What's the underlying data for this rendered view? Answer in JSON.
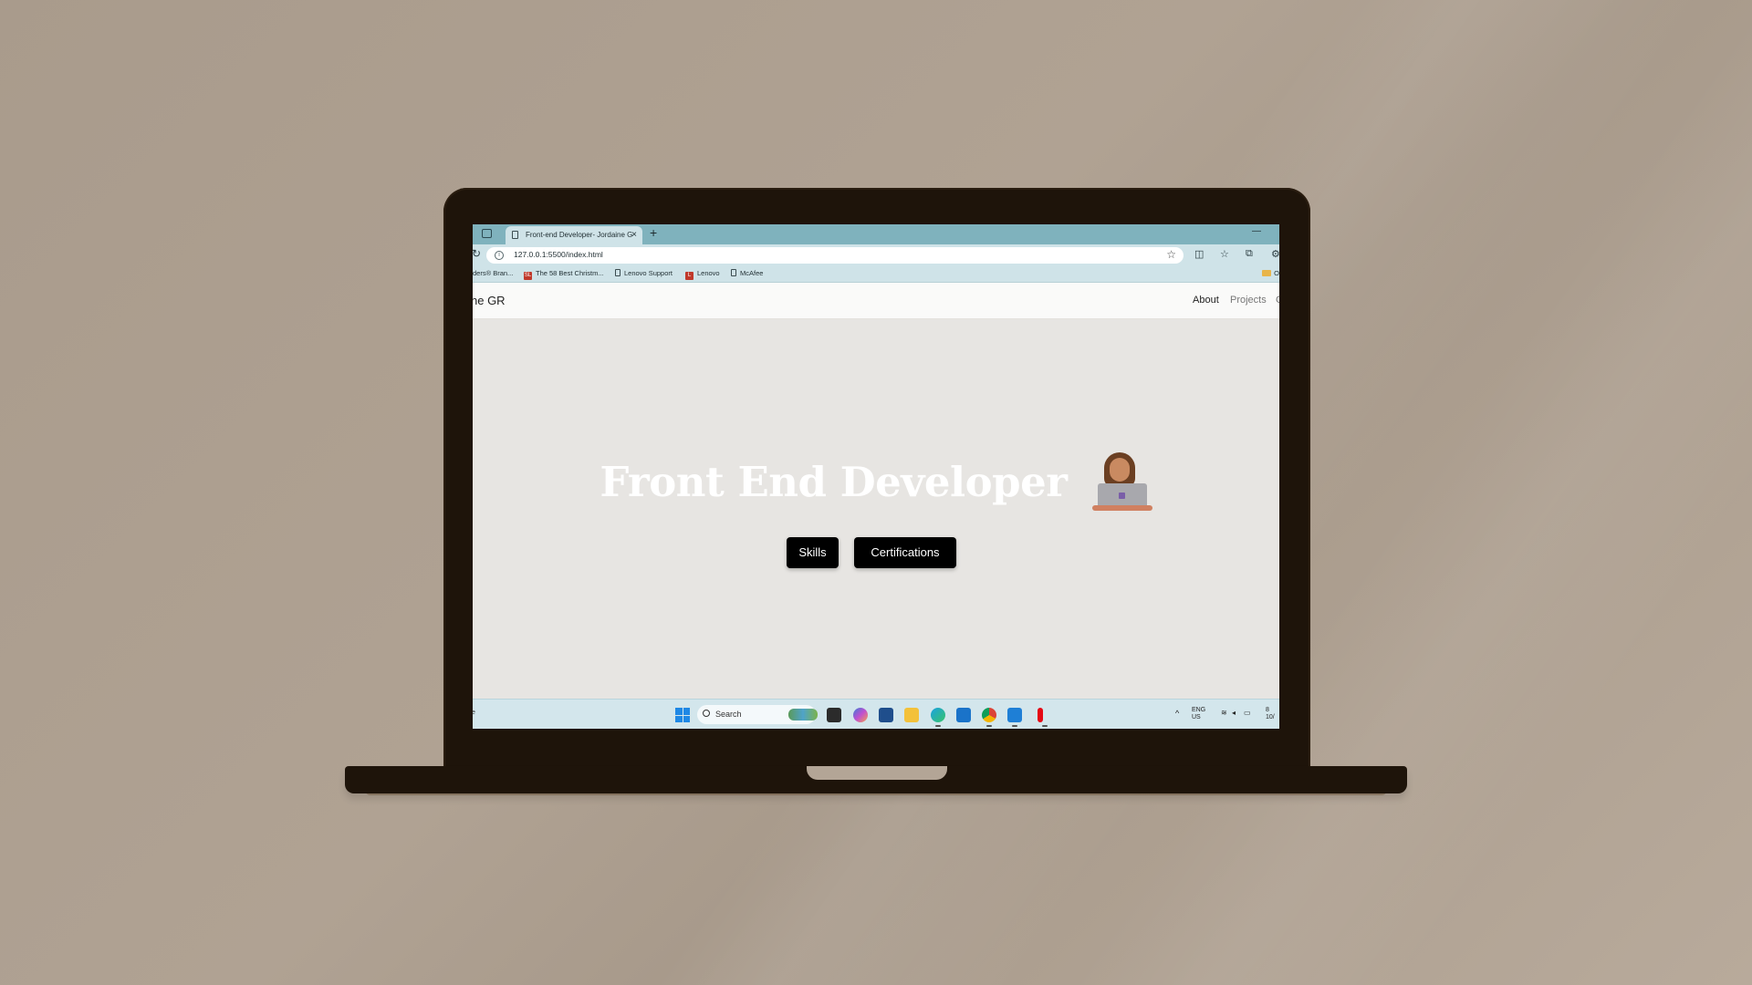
{
  "browser": {
    "tab_title": "Front-end Developer- Jordaine G",
    "tab_close": "×",
    "new_tab": "+",
    "window_minimize": "—",
    "url": "127.0.0.1:5500/index.html",
    "bookmarks": [
      {
        "label": "ders® Bran...",
        "icon": "none"
      },
      {
        "label": "The 58 Best Christm...",
        "icon": "red-badge",
        "badge": "SL"
      },
      {
        "label": "Lenovo Support",
        "icon": "doc"
      },
      {
        "label": "Lenovo",
        "icon": "red-badge",
        "badge": "L"
      },
      {
        "label": "McAfee",
        "icon": "doc"
      }
    ],
    "bookmarks_folder": "Ot"
  },
  "page": {
    "brand": "ne GR",
    "nav": [
      {
        "label": "About",
        "active": true
      },
      {
        "label": "Projects",
        "active": false
      },
      {
        "label": "C",
        "active": false
      }
    ],
    "hero_title": "Front End Developer",
    "hero_emoji": "woman-technologist-emoji",
    "buttons": {
      "skills": "Skills",
      "certifications": "Certifications"
    }
  },
  "taskbar": {
    "left_text": "e",
    "search_placeholder": "Search",
    "tray": {
      "lang_top": "ENG",
      "lang_bottom": "US",
      "time_top": "8",
      "date_bottom": "10/"
    }
  },
  "colors": {
    "wallpaper": "#ac9e8f",
    "laptop_body": "#1e140a",
    "browser_tabbar": "#7fb2bd",
    "browser_chrome": "#cfe3e8",
    "page_background": "#e7e5e2",
    "button_bg": "#000000",
    "taskbar": "#d3e6ec"
  }
}
